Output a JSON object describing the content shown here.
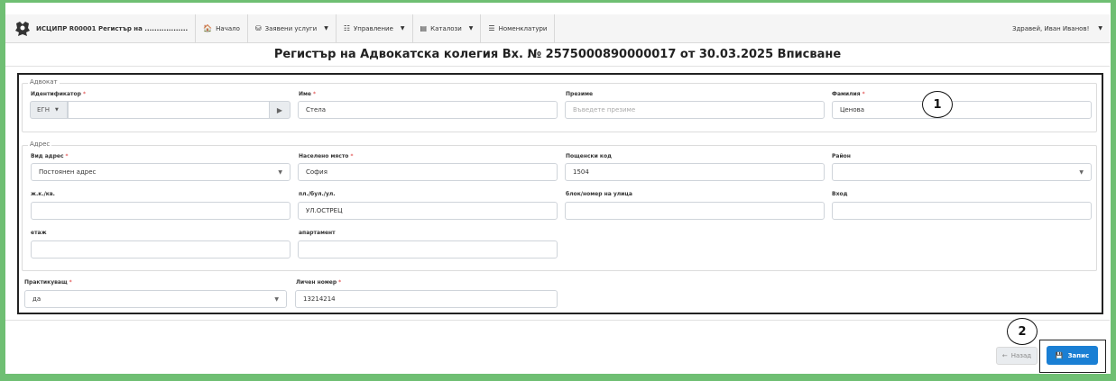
{
  "navbar": {
    "brand": "ИСЦИПР R00001 Регистър на ..................",
    "items": [
      {
        "icon": "home-icon",
        "glyph": "🏠",
        "label": "Начало",
        "dropdown": false
      },
      {
        "icon": "database-icon",
        "glyph": "⛁",
        "label": "Заявени услуги",
        "dropdown": true
      },
      {
        "icon": "management-icon",
        "glyph": "☷",
        "label": "Управление",
        "dropdown": true
      },
      {
        "icon": "catalog-icon",
        "glyph": "▤",
        "label": "Каталози",
        "dropdown": true
      },
      {
        "icon": "list-icon",
        "glyph": "☰",
        "label": "Номенклатури",
        "dropdown": false
      }
    ],
    "user": "Здравей, Иван Иванов!"
  },
  "page_title": "Регистър на Адвокатска колегия Вх. № 2575000890000017 от 30.03.2025 Вписване",
  "lawyer_section": {
    "legend": "Адвокат",
    "identifier": {
      "label": "Идентификатор",
      "type_value": "ЕГН",
      "value": ""
    },
    "first_name": {
      "label": "Име",
      "value": "Стела"
    },
    "middle_name": {
      "label": "Презиме",
      "placeholder": "Въведете презиме"
    },
    "last_name": {
      "label": "Фамилия",
      "value": "Ценова"
    }
  },
  "address_section": {
    "legend": "Адрес",
    "address_type": {
      "label": "Вид адрес",
      "value": "Постоянен адрес"
    },
    "settlement": {
      "label": "Населено място",
      "value": "София"
    },
    "postal_code": {
      "label": "Пощенски код",
      "value": "1504"
    },
    "district": {
      "label": "Район",
      "value": ""
    },
    "complex": {
      "label": "ж.к./кв.",
      "value": ""
    },
    "street": {
      "label": "пл./бул./ул.",
      "value": "УЛ.ОСТРЕЦ"
    },
    "block": {
      "label": "блок/номер на улица",
      "value": ""
    },
    "entrance": {
      "label": "Вход",
      "value": ""
    },
    "floor": {
      "label": "етаж",
      "value": ""
    },
    "apartment": {
      "label": "апартамент",
      "value": ""
    }
  },
  "practicing": {
    "label": "Практикуващ",
    "value": "да"
  },
  "personal_number": {
    "label": "Личен номер",
    "value": "13214214"
  },
  "annotations": {
    "badge1": "1",
    "badge2": "2"
  },
  "buttons": {
    "back": "Назад",
    "save": "Запис"
  },
  "colors": {
    "frame": "#6fbf73",
    "primary": "#1a7fd4",
    "required": "#d33333"
  }
}
